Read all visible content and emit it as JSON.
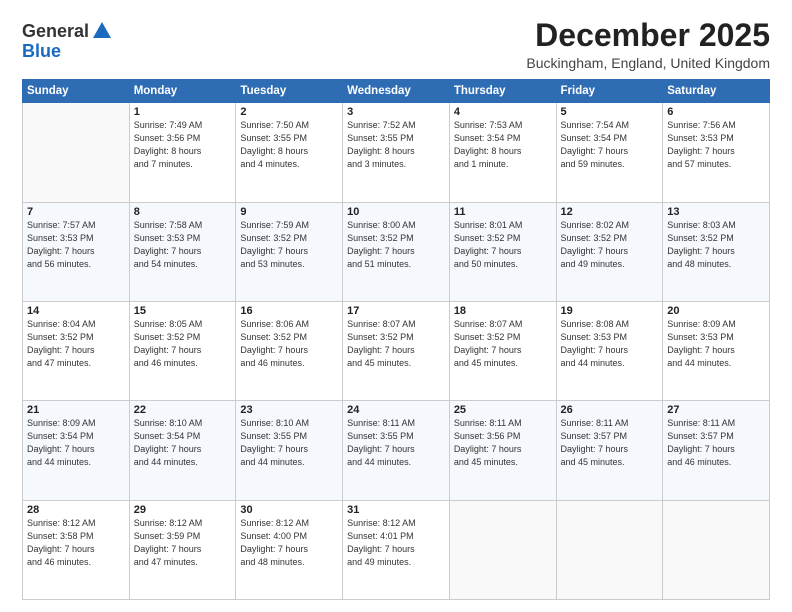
{
  "logo": {
    "general": "General",
    "blue": "Blue"
  },
  "header": {
    "month_title": "December 2025",
    "location": "Buckingham, England, United Kingdom"
  },
  "days_of_week": [
    "Sunday",
    "Monday",
    "Tuesday",
    "Wednesday",
    "Thursday",
    "Friday",
    "Saturday"
  ],
  "weeks": [
    [
      {
        "day": "",
        "info": ""
      },
      {
        "day": "1",
        "info": "Sunrise: 7:49 AM\nSunset: 3:56 PM\nDaylight: 8 hours\nand 7 minutes."
      },
      {
        "day": "2",
        "info": "Sunrise: 7:50 AM\nSunset: 3:55 PM\nDaylight: 8 hours\nand 4 minutes."
      },
      {
        "day": "3",
        "info": "Sunrise: 7:52 AM\nSunset: 3:55 PM\nDaylight: 8 hours\nand 3 minutes."
      },
      {
        "day": "4",
        "info": "Sunrise: 7:53 AM\nSunset: 3:54 PM\nDaylight: 8 hours\nand 1 minute."
      },
      {
        "day": "5",
        "info": "Sunrise: 7:54 AM\nSunset: 3:54 PM\nDaylight: 7 hours\nand 59 minutes."
      },
      {
        "day": "6",
        "info": "Sunrise: 7:56 AM\nSunset: 3:53 PM\nDaylight: 7 hours\nand 57 minutes."
      }
    ],
    [
      {
        "day": "7",
        "info": "Sunrise: 7:57 AM\nSunset: 3:53 PM\nDaylight: 7 hours\nand 56 minutes."
      },
      {
        "day": "8",
        "info": "Sunrise: 7:58 AM\nSunset: 3:53 PM\nDaylight: 7 hours\nand 54 minutes."
      },
      {
        "day": "9",
        "info": "Sunrise: 7:59 AM\nSunset: 3:52 PM\nDaylight: 7 hours\nand 53 minutes."
      },
      {
        "day": "10",
        "info": "Sunrise: 8:00 AM\nSunset: 3:52 PM\nDaylight: 7 hours\nand 51 minutes."
      },
      {
        "day": "11",
        "info": "Sunrise: 8:01 AM\nSunset: 3:52 PM\nDaylight: 7 hours\nand 50 minutes."
      },
      {
        "day": "12",
        "info": "Sunrise: 8:02 AM\nSunset: 3:52 PM\nDaylight: 7 hours\nand 49 minutes."
      },
      {
        "day": "13",
        "info": "Sunrise: 8:03 AM\nSunset: 3:52 PM\nDaylight: 7 hours\nand 48 minutes."
      }
    ],
    [
      {
        "day": "14",
        "info": "Sunrise: 8:04 AM\nSunset: 3:52 PM\nDaylight: 7 hours\nand 47 minutes."
      },
      {
        "day": "15",
        "info": "Sunrise: 8:05 AM\nSunset: 3:52 PM\nDaylight: 7 hours\nand 46 minutes."
      },
      {
        "day": "16",
        "info": "Sunrise: 8:06 AM\nSunset: 3:52 PM\nDaylight: 7 hours\nand 46 minutes."
      },
      {
        "day": "17",
        "info": "Sunrise: 8:07 AM\nSunset: 3:52 PM\nDaylight: 7 hours\nand 45 minutes."
      },
      {
        "day": "18",
        "info": "Sunrise: 8:07 AM\nSunset: 3:52 PM\nDaylight: 7 hours\nand 45 minutes."
      },
      {
        "day": "19",
        "info": "Sunrise: 8:08 AM\nSunset: 3:53 PM\nDaylight: 7 hours\nand 44 minutes."
      },
      {
        "day": "20",
        "info": "Sunrise: 8:09 AM\nSunset: 3:53 PM\nDaylight: 7 hours\nand 44 minutes."
      }
    ],
    [
      {
        "day": "21",
        "info": "Sunrise: 8:09 AM\nSunset: 3:54 PM\nDaylight: 7 hours\nand 44 minutes."
      },
      {
        "day": "22",
        "info": "Sunrise: 8:10 AM\nSunset: 3:54 PM\nDaylight: 7 hours\nand 44 minutes."
      },
      {
        "day": "23",
        "info": "Sunrise: 8:10 AM\nSunset: 3:55 PM\nDaylight: 7 hours\nand 44 minutes."
      },
      {
        "day": "24",
        "info": "Sunrise: 8:11 AM\nSunset: 3:55 PM\nDaylight: 7 hours\nand 44 minutes."
      },
      {
        "day": "25",
        "info": "Sunrise: 8:11 AM\nSunset: 3:56 PM\nDaylight: 7 hours\nand 45 minutes."
      },
      {
        "day": "26",
        "info": "Sunrise: 8:11 AM\nSunset: 3:57 PM\nDaylight: 7 hours\nand 45 minutes."
      },
      {
        "day": "27",
        "info": "Sunrise: 8:11 AM\nSunset: 3:57 PM\nDaylight: 7 hours\nand 46 minutes."
      }
    ],
    [
      {
        "day": "28",
        "info": "Sunrise: 8:12 AM\nSunset: 3:58 PM\nDaylight: 7 hours\nand 46 minutes."
      },
      {
        "day": "29",
        "info": "Sunrise: 8:12 AM\nSunset: 3:59 PM\nDaylight: 7 hours\nand 47 minutes."
      },
      {
        "day": "30",
        "info": "Sunrise: 8:12 AM\nSunset: 4:00 PM\nDaylight: 7 hours\nand 48 minutes."
      },
      {
        "day": "31",
        "info": "Sunrise: 8:12 AM\nSunset: 4:01 PM\nDaylight: 7 hours\nand 49 minutes."
      },
      {
        "day": "",
        "info": ""
      },
      {
        "day": "",
        "info": ""
      },
      {
        "day": "",
        "info": ""
      }
    ]
  ]
}
